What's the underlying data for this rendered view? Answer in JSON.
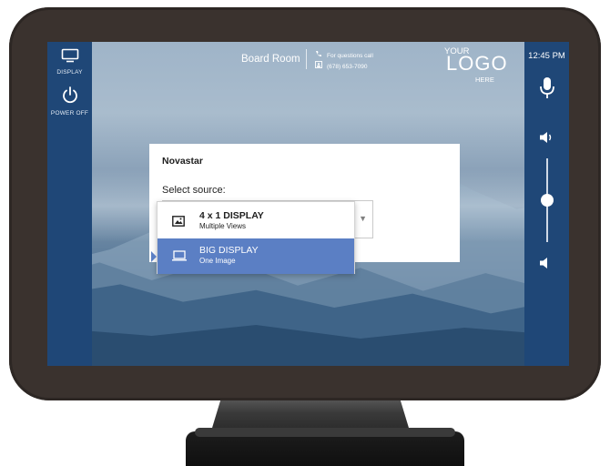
{
  "left_bar": {
    "display_label": "DISPLAY",
    "power_label": "POWER OFF"
  },
  "header": {
    "room_name": "Board Room",
    "contact_line1": "For questions call",
    "contact_line2": "(678) 653-7090",
    "logo_top": "YOUR",
    "logo_main": "LOGO",
    "logo_bottom": "HERE"
  },
  "right_bar": {
    "clock": "12:45 PM",
    "volume_level": 0.5
  },
  "dialog": {
    "title": "Novastar",
    "select_label": "Select source:"
  },
  "dropdown": {
    "options": [
      {
        "title": "4 x 1 DISPLAY",
        "subtitle": "Multiple Views",
        "icon": "display-wall-icon"
      },
      {
        "title": "BIG DISPLAY",
        "subtitle": "One Image",
        "icon": "laptop-icon",
        "selected": true
      }
    ]
  },
  "colors": {
    "sidebar": "#1f4777",
    "bezel": "#3a322e",
    "selected_option": "#5b7fc4"
  }
}
